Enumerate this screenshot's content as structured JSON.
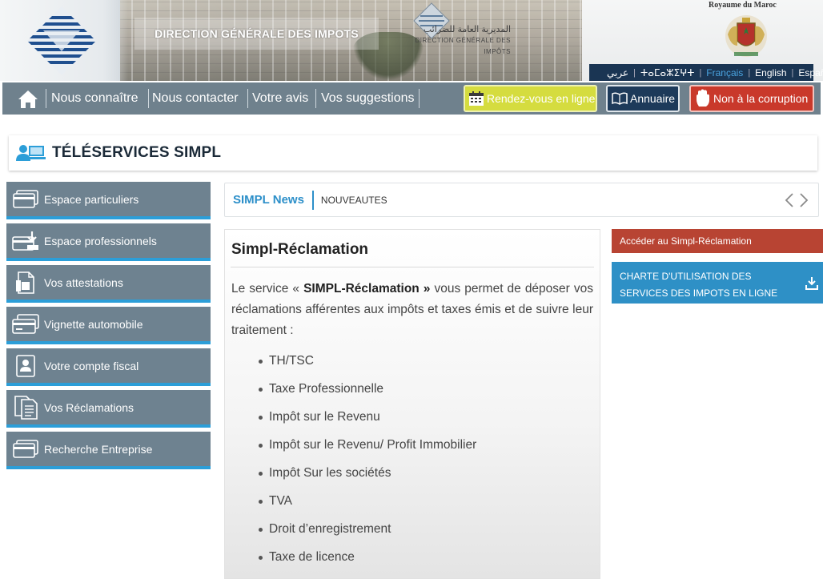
{
  "header": {
    "title": "DIRECTION GÉNÉRALE DES IMPOTS",
    "arabic_title": "المديرية العامة للضرائب",
    "arabic_sub": "DIRECTION GÉNÉRALE DES IMPÔTS",
    "royaume": "Royaume du Maroc",
    "languages": [
      "عربي",
      "ⵜⴰⵎⴰⵣⵉⵖⵜ",
      "Français",
      "English",
      "Español"
    ],
    "active_language": "Français"
  },
  "nav": {
    "home_icon": "home-icon",
    "links": [
      "Nous connaître",
      "Nous contacter",
      "Votre avis",
      "Vos suggestions"
    ],
    "rdv_label": "Rendez-vous en ligne",
    "annuaire_label": "Annuaire",
    "corruption_label": "Non à la corruption"
  },
  "section": {
    "title": "TÉLÉSERVICES SIMPL"
  },
  "sidebar": {
    "items": [
      {
        "label": "Espace particuliers",
        "icon": "card-icon"
      },
      {
        "label": "Espace professionnels",
        "icon": "download-card-icon"
      },
      {
        "label": "Vos attestations",
        "icon": "document-icon"
      },
      {
        "label": "Vignette automobile",
        "icon": "card-icon"
      },
      {
        "label": "Votre compte fiscal",
        "icon": "profile-card-icon"
      },
      {
        "label": "Vos Réclamations",
        "icon": "documents-icon"
      },
      {
        "label": "Recherche Entreprise",
        "icon": "card-icon"
      }
    ]
  },
  "news": {
    "label": "SIMPL News",
    "text": "NOUVEAUTES"
  },
  "content": {
    "heading": "Simpl-Réclamation",
    "intro_before": "Le service « ",
    "intro_bold": "SIMPL-Réclamation »",
    "intro_after": " vous permet de déposer vos réclamations afférentes aux impôts et taxes émis et de suivre leur traitement :",
    "list": [
      "TH/TSC",
      "Taxe Professionnelle",
      "Impôt sur le Revenu",
      "Impôt sur le Revenu/ Profit Immobilier",
      "Impôt Sur les sociétés",
      "TVA",
      "Droit d’enregistrement",
      "Taxe de licence"
    ]
  },
  "right": {
    "access_label": "Accéder au Simpl-Réclamation",
    "charte_label": "CHARTE D'UTILISATION DES SERVICES DES IMPOTS EN LIGNE"
  },
  "colors": {
    "nav_bg": "#6f818d",
    "accent_blue": "#2c9ed8",
    "rdv_green": "#d5dc3f",
    "annuaire_navy": "#1d3a5a",
    "corruption_red": "#c9392b",
    "access_red": "#b84433",
    "charte_blue": "#2e90c6"
  }
}
